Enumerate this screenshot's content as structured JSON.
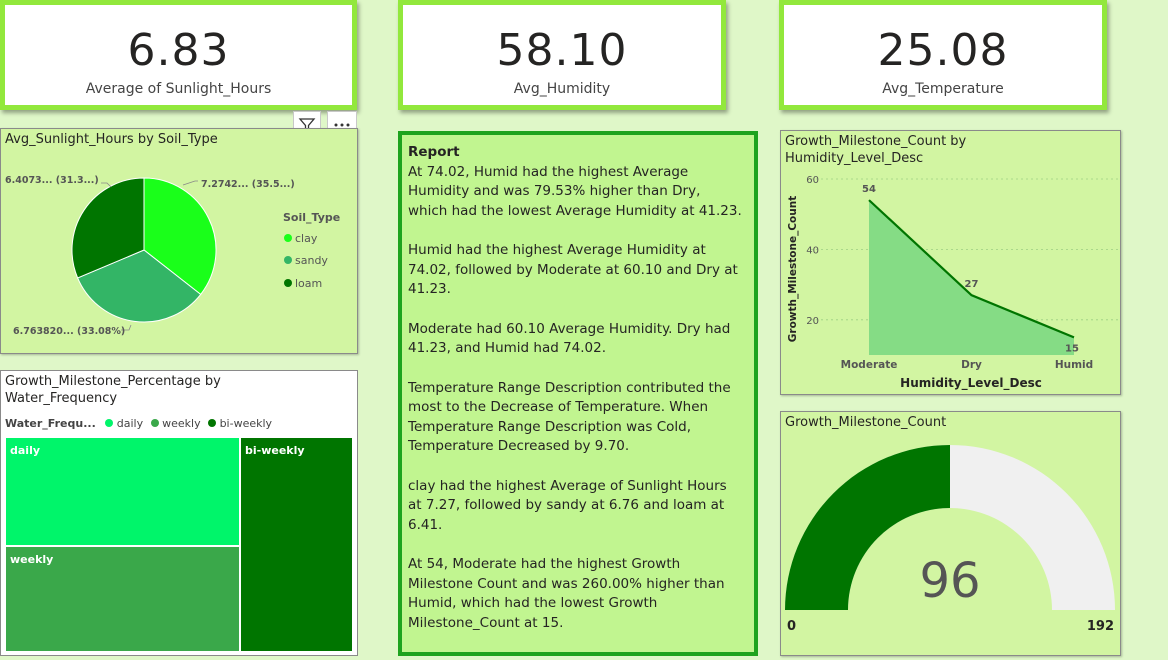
{
  "kpis": [
    {
      "value": "6.83",
      "label": "Average of Sunlight_Hours"
    },
    {
      "value": "58.10",
      "label": "Avg_Humidity"
    },
    {
      "value": "25.08",
      "label": "Avg_Temperature"
    }
  ],
  "pie": {
    "title": "Avg_Sunlight_Hours by Soil_Type",
    "legend_title": "Soil_Type",
    "labels": [
      "7.2742... (35.5...)",
      "6.763820... (33.08%)",
      "6.4073... (31.3...)"
    ],
    "colors": {
      "clay": "#1aff1a",
      "sandy": "#33b566",
      "loam": "#007500"
    }
  },
  "treemap": {
    "title": "Growth_Milestone_Percentage by Water_Frequency",
    "legend_title": "Water_Frequ...",
    "cells": [
      "daily",
      "weekly",
      "bi-weekly"
    ],
    "colors": {
      "daily": "#00f56a",
      "weekly": "#3aa84a",
      "bi-weekly": "#007500"
    }
  },
  "report": {
    "heading": "Report",
    "paragraphs": [
      "At 74.02, Humid had the highest Average Humidity and was 79.53% higher than Dry, which had the lowest Average Humidity at 41.23.",
      "Humid had the highest Average Humidity at 74.02, followed by Moderate at 60.10 and Dry at 41.23.",
      "Moderate had 60.10 Average Humidity. Dry had 41.23, and Humid had 74.02.",
      "Temperature Range Description contributed the most to the Decrease of Temperature. When Temperature Range Description was Cold, Temperature Decreased by 9.70.",
      "clay had the highest Average of Sunlight Hours at 7.27, followed by sandy at 6.76 and loam at 6.41.",
      "At 54, Moderate had the highest Growth Milestone Count and was 260.00% higher than Humid, which had the lowest Growth Milestone_Count at 15."
    ]
  },
  "area_chart": {
    "title": "Growth_Milestone_Count by Humidity_Level_Desc",
    "xlabel": "Humidity_Level_Desc",
    "ylabel": "Growth_Milestone_Count",
    "ytick_labels": [
      "60",
      "40",
      "20"
    ]
  },
  "gauge": {
    "title": "Growth_Milestone_Count",
    "value_text": "96",
    "min_text": "0",
    "max_text": "192",
    "value": 96,
    "min": 0,
    "max": 192,
    "fill_color": "#007500",
    "track_color": "#f0f0f0"
  },
  "chart_data": [
    {
      "type": "pie",
      "title": "Avg_Sunlight_Hours by Soil_Type",
      "categories": [
        "clay",
        "sandy",
        "loam"
      ],
      "values": [
        7.2742,
        6.76382,
        6.4073
      ],
      "percent": [
        35.5,
        33.08,
        31.3
      ],
      "legend": "right"
    },
    {
      "type": "area",
      "title": "Growth_Milestone_Count by Humidity_Level_Desc",
      "categories": [
        "Moderate",
        "Dry",
        "Humid"
      ],
      "values": [
        54,
        27,
        15
      ],
      "xlabel": "Humidity_Level_Desc",
      "ylabel": "Growth_Milestone_Count",
      "ylim": [
        10,
        60
      ],
      "yticks": [
        20,
        40,
        60
      ],
      "grid": true,
      "color": "#007500"
    },
    {
      "type": "heatmap",
      "title": "Growth_Milestone_Percentage by Water_Frequency",
      "categories": [
        "daily",
        "weekly",
        "bi-weekly"
      ]
    }
  ]
}
